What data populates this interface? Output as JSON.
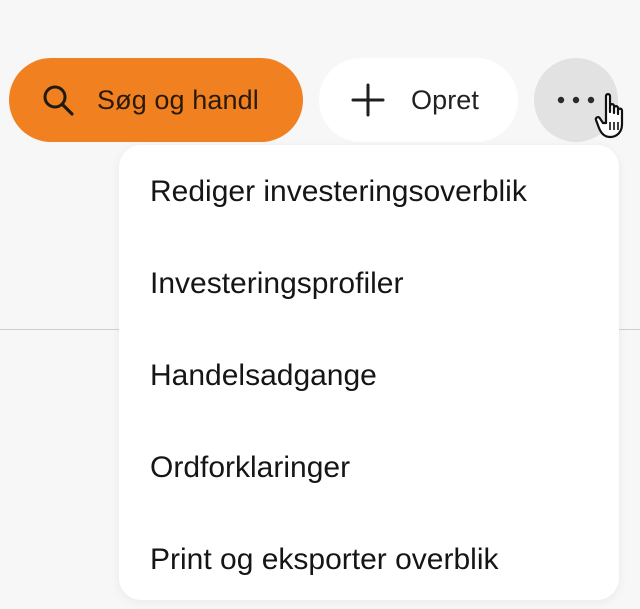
{
  "toolbar": {
    "search_button": {
      "label": "Søg og handl",
      "icon": "search-icon",
      "color": "#f08020"
    },
    "create_button": {
      "label": "Opret",
      "icon": "plus-icon"
    },
    "more_button": {
      "icon": "more-horizontal-icon"
    }
  },
  "cursor": {
    "icon": "hand-pointer-icon"
  },
  "menu": {
    "items": [
      {
        "label": "Rediger investeringsoverblik"
      },
      {
        "label": "Investeringsprofiler"
      },
      {
        "label": "Handelsadgange"
      },
      {
        "label": "Ordforklaringer"
      },
      {
        "label": "Print og eksporter overblik"
      }
    ]
  }
}
